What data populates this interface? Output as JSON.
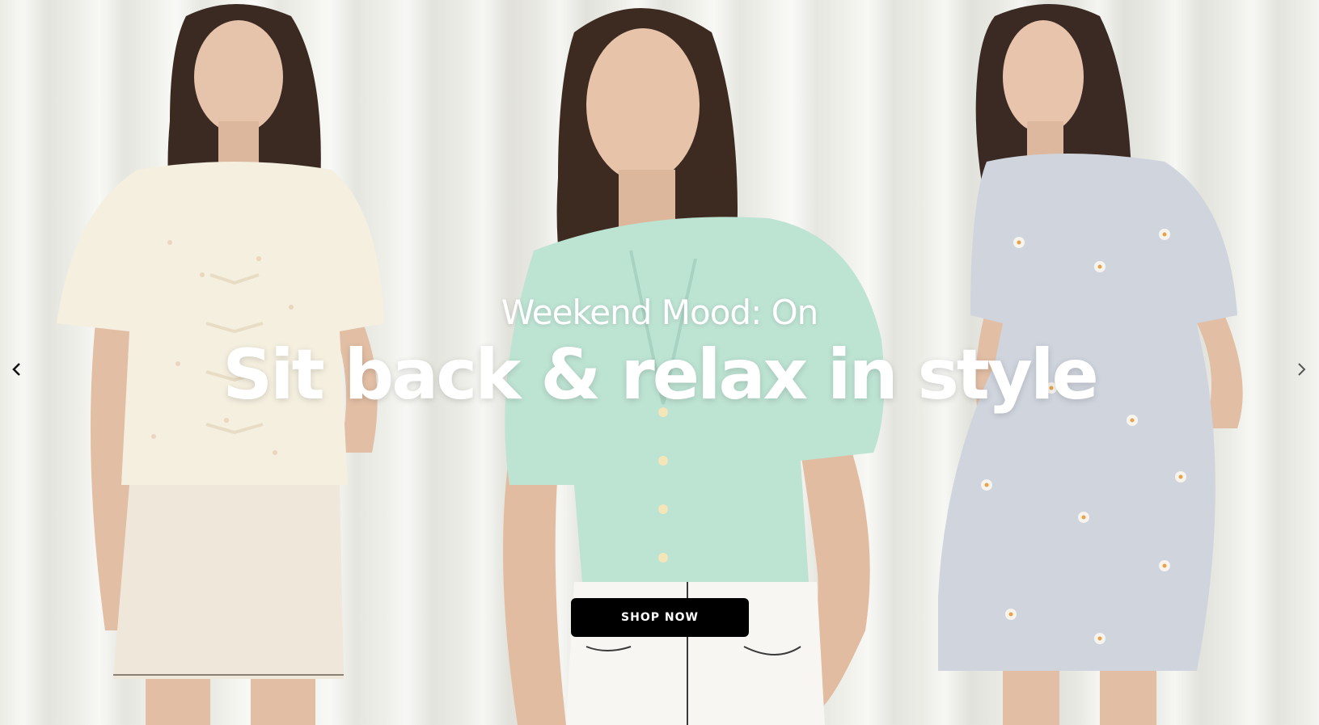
{
  "hero": {
    "subtitle": "Weekend Mood: On",
    "headline": "Sit back & relax in style",
    "cta_label": "SHOP NOW"
  },
  "carousel": {
    "prev_icon": "chevron-left-icon",
    "next_icon": "chevron-right-icon"
  },
  "colors": {
    "cta_background": "#000000",
    "cta_text": "#ffffff",
    "headline_text": "#ffffff"
  }
}
